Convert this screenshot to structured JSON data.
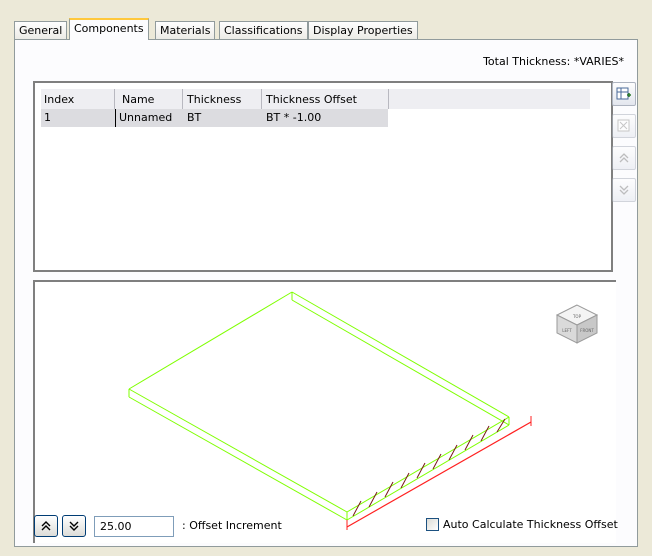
{
  "tabs": [
    {
      "label": "General"
    },
    {
      "label": "Components"
    },
    {
      "label": "Materials"
    },
    {
      "label": "Classifications"
    },
    {
      "label": "Display Properties"
    }
  ],
  "active_tab": "Components",
  "total_thickness": "Total Thickness: *VARIES*",
  "grid": {
    "columns": [
      "Index",
      "Name",
      "Thickness",
      "Thickness Offset"
    ],
    "rows": [
      {
        "index": "1",
        "name": "Unnamed",
        "thickness": "BT",
        "offset": "BT * -1.00"
      }
    ]
  },
  "side_buttons": [
    {
      "icon": "add-component-icon",
      "enabled": true
    },
    {
      "icon": "remove-component-icon",
      "enabled": false
    },
    {
      "icon": "move-up-icon",
      "enabled": false
    },
    {
      "icon": "move-down-icon",
      "enabled": false
    }
  ],
  "viewcube": {
    "top": "TOP",
    "left": "LEFT",
    "front": "FRONT"
  },
  "colors": {
    "slab_edge": "#7fff00",
    "offset_line": "#ff2020",
    "hatch": "#7a1a1a"
  },
  "bottom": {
    "increment_value": "25.00",
    "increment_label": ": Offset Increment",
    "auto_calc_label": "Auto Calculate Thickness Offset",
    "auto_calc_checked": false
  }
}
